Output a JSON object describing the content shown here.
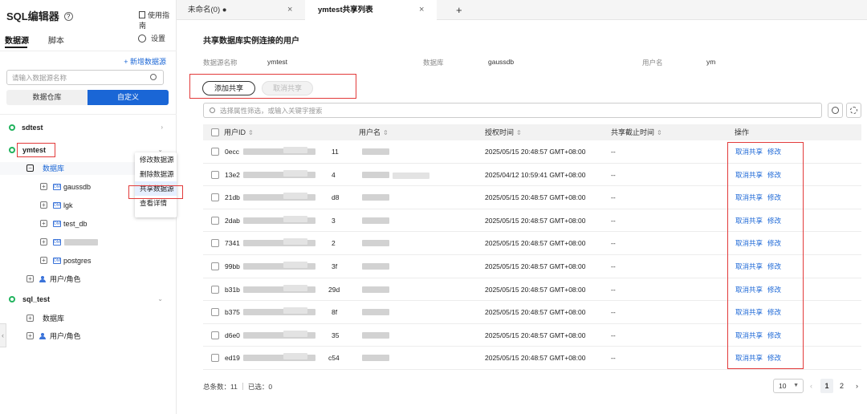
{
  "app": {
    "title": "SQL编辑器",
    "help_icon": "question-circle-icon",
    "guide": "使用指南"
  },
  "sidebar": {
    "tabs": [
      "数据源",
      "脚本"
    ],
    "settings": "设置",
    "add_datasource": "+ 新增数据源",
    "search_placeholder": "请输入数据源名称",
    "segments": [
      "数据仓库",
      "自定义"
    ],
    "tree": {
      "sdtest": "sdtest",
      "ymtest": "ymtest",
      "db_folder": "数据库",
      "databases": [
        "gaussdb",
        "lgk",
        "test_db",
        "",
        "postgres"
      ],
      "users_roles": "用户/角色",
      "sql_test": "sql_test",
      "sql_test_db": "数据库",
      "sql_test_users": "用户/角色"
    },
    "context_menu": [
      "修改数据源",
      "删除数据源",
      "共享数据源",
      "查看详情"
    ]
  },
  "tabs": [
    {
      "label": "未命名(0) ●"
    },
    {
      "label": "ymtest共享列表"
    },
    {
      "label": "+"
    }
  ],
  "main": {
    "title": "共享数据库实例连接的用户",
    "info": {
      "ds_key": "数据源名称",
      "ds_val": "ymtest",
      "db_key": "数据库",
      "db_val": "gaussdb",
      "user_key": "用户名",
      "user_val": "ym"
    },
    "add_share": "添加共享",
    "cancel_share": "取消共享",
    "filter_placeholder": "选择属性筛选，或输入关键字搜索",
    "columns": [
      "用户ID",
      "用户名",
      "授权时间",
      "共享截止时间",
      "操作"
    ],
    "rows": [
      {
        "id_start": "0ecc",
        "id_end": "11",
        "time": "2025/05/15 20:48:57 GMT+08:00",
        "deadline": "--"
      },
      {
        "id_start": "13e2",
        "id_end": "4",
        "time": "2025/04/12 10:59:41 GMT+08:00",
        "deadline": "--"
      },
      {
        "id_start": "21db",
        "id_end": "d8",
        "time": "2025/05/15 20:48:57 GMT+08:00",
        "deadline": "--"
      },
      {
        "id_start": "2dab",
        "id_end": "3",
        "time": "2025/05/15 20:48:57 GMT+08:00",
        "deadline": "--"
      },
      {
        "id_start": "7341",
        "id_end": "2",
        "time": "2025/05/15 20:48:57 GMT+08:00",
        "deadline": "--"
      },
      {
        "id_start": "99bb",
        "id_end": "3f",
        "time": "2025/05/15 20:48:57 GMT+08:00",
        "deadline": "--"
      },
      {
        "id_start": "b31b",
        "id_end": "29d",
        "time": "2025/05/15 20:48:57 GMT+08:00",
        "deadline": "--"
      },
      {
        "id_start": "b375",
        "id_end": "8f",
        "time": "2025/05/15 20:48:57 GMT+08:00",
        "deadline": "--"
      },
      {
        "id_start": "d6e0",
        "id_end": "35",
        "time": "2025/05/15 20:48:57 GMT+08:00",
        "deadline": "--"
      },
      {
        "id_start": "ed19",
        "id_end": "c54",
        "time": "2025/05/15 20:48:57 GMT+08:00",
        "deadline": "--"
      }
    ],
    "action_cancel": "取消共享",
    "action_edit": "修改",
    "footer": {
      "total": "总条数：11",
      "selected": "已选：0"
    },
    "pagination": {
      "page_size": "10",
      "pages": [
        "1",
        "2"
      ]
    }
  },
  "colors": {
    "accent": "#1a66d6",
    "highlight": "#e23a3a",
    "online": "#22b35e"
  }
}
